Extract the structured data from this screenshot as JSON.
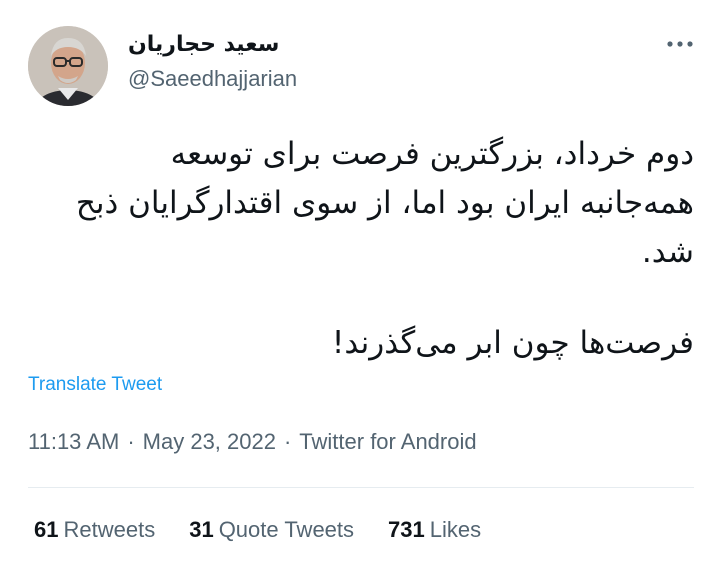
{
  "author": {
    "display_name": "سعید حجاریان",
    "username": "@Saeedhajjarian"
  },
  "tweet": {
    "lines": [
      "دوم خرداد، بزرگترین فرصت برای توسعه",
      "همه‌جانبه ایران بود اما، از سوی اقتدارگرایان ذبح",
      "شد.",
      "فرصت‌ها چون ابر می‌گذرند!"
    ],
    "translate_label": "Translate Tweet"
  },
  "meta": {
    "time": "11:13 AM",
    "separator": "·",
    "date": "May 23, 2022",
    "source": "Twitter for Android"
  },
  "stats": {
    "retweets_count": "61",
    "retweets_label": "Retweets",
    "quotes_count": "31",
    "quotes_label": "Quote Tweets",
    "likes_count": "731",
    "likes_label": "Likes"
  },
  "icons": {
    "more": "more-horizontal-icon"
  },
  "colors": {
    "link": "#1d9bf0",
    "secondary_text": "#536471",
    "primary_text": "#0f1419",
    "divider": "#e6ecf0"
  }
}
